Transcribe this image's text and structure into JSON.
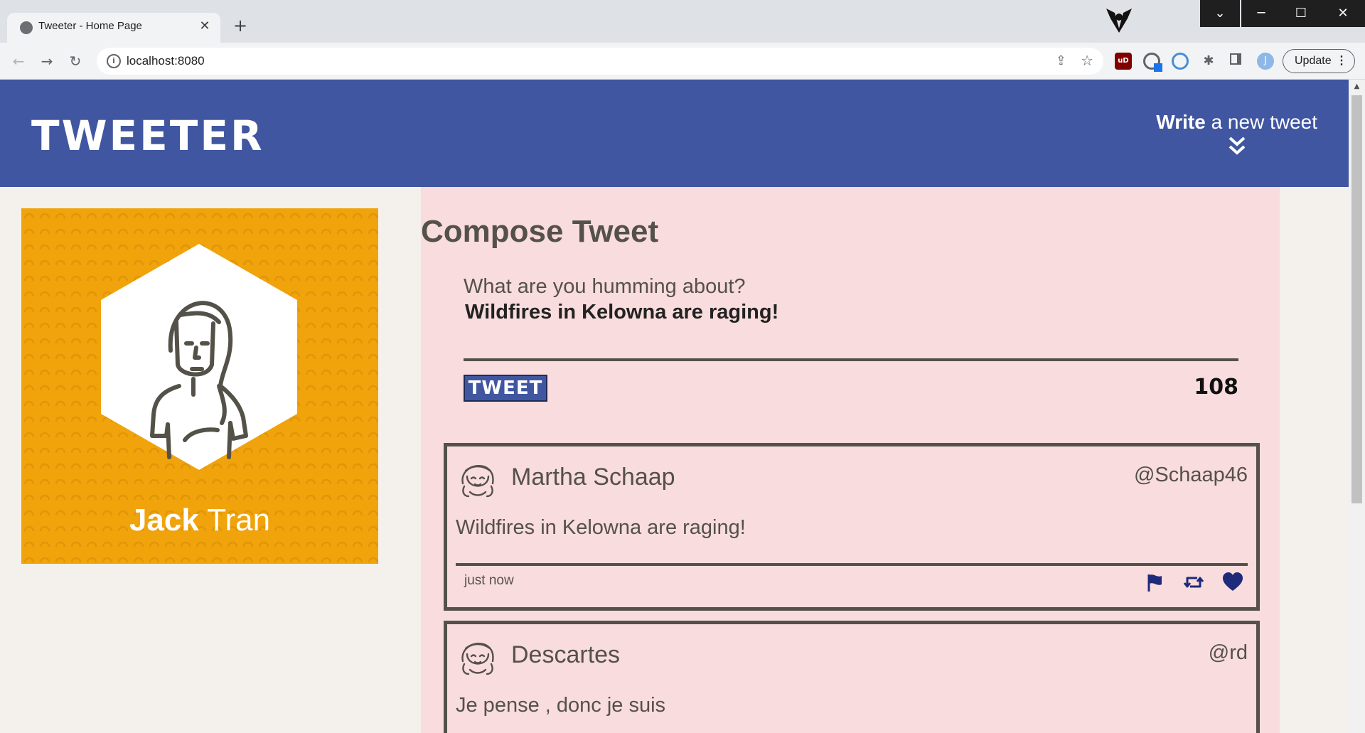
{
  "browser": {
    "tab_title": "Tweeter - Home Page",
    "url": "localhost:8080",
    "update_label": "Update",
    "avatar_initial": "J",
    "ublock_label": "uD"
  },
  "site": {
    "logo": "TWEETER",
    "nav_write_bold": "Write",
    "nav_write_rest": " a new tweet"
  },
  "profile": {
    "first_name": "Jack",
    "last_name": "Tran",
    "card_color": "#f0a30a"
  },
  "compose": {
    "title": "Compose Tweet",
    "label": "What are you humming about?",
    "value": "Wildfires in Kelowna are raging!",
    "button_label": "TWEET",
    "counter": "108"
  },
  "tweets": [
    {
      "name": "Martha Schaap",
      "handle": "@Schaap46",
      "content": "Wildfires in Kelowna are raging!",
      "time": "just now"
    },
    {
      "name": "Descartes",
      "handle": "@rd",
      "content": "Je pense , donc je suis"
    }
  ],
  "colors": {
    "header": "#4056a1",
    "main_bg": "#f9dcdd",
    "page_bg": "#f4f1ec",
    "text": "#545149",
    "action_icons": "#1e2a7a"
  },
  "icons": {
    "flag": "flag-icon",
    "retweet": "retweet-icon",
    "like": "heart-icon",
    "write": "double-chevron-down-icon"
  }
}
